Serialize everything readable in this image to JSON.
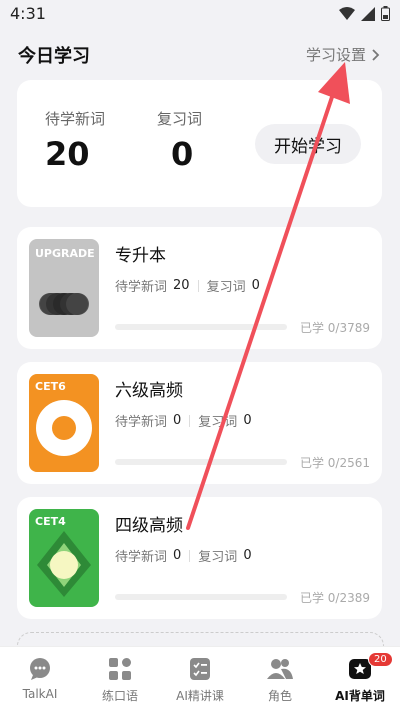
{
  "status": {
    "time": "4:31"
  },
  "header": {
    "title": "今日学习",
    "settings_label": "学习设置"
  },
  "summary": {
    "new_words_label": "待学新词",
    "new_words_value": "20",
    "review_label": "复习词",
    "review_value": "0",
    "start_button": "开始学习"
  },
  "books": [
    {
      "tag": "UPGRADE",
      "title": "专升本",
      "new_label": "待学新词",
      "new_value": "20",
      "review_label": "复习词",
      "review_value": "0",
      "progress_text": "已学 0/3789",
      "progress": 0,
      "cover_color": "#c4c4c4"
    },
    {
      "tag": "CET6",
      "title": "六级高频",
      "new_label": "待学新词",
      "new_value": "0",
      "review_label": "复习词",
      "review_value": "0",
      "progress_text": "已学 0/2561",
      "progress": 0,
      "cover_color": "#f39222"
    },
    {
      "tag": "CET4",
      "title": "四级高频",
      "new_label": "待学新词",
      "new_value": "0",
      "review_label": "复习词",
      "review_value": "0",
      "progress_text": "已学 0/2389",
      "progress": 0,
      "cover_color": "#3fb44a"
    }
  ],
  "nav": [
    {
      "label": "TalkAI",
      "icon": "chat-bubble-icon"
    },
    {
      "label": "练口语",
      "icon": "grid-icon"
    },
    {
      "label": "AI精讲课",
      "icon": "checklist-icon"
    },
    {
      "label": "角色",
      "icon": "people-icon"
    },
    {
      "label": "AI背单词",
      "icon": "vocab-card-icon",
      "badge": "20",
      "active": true
    }
  ],
  "colors": {
    "annotation_arrow": "#f0505a"
  }
}
